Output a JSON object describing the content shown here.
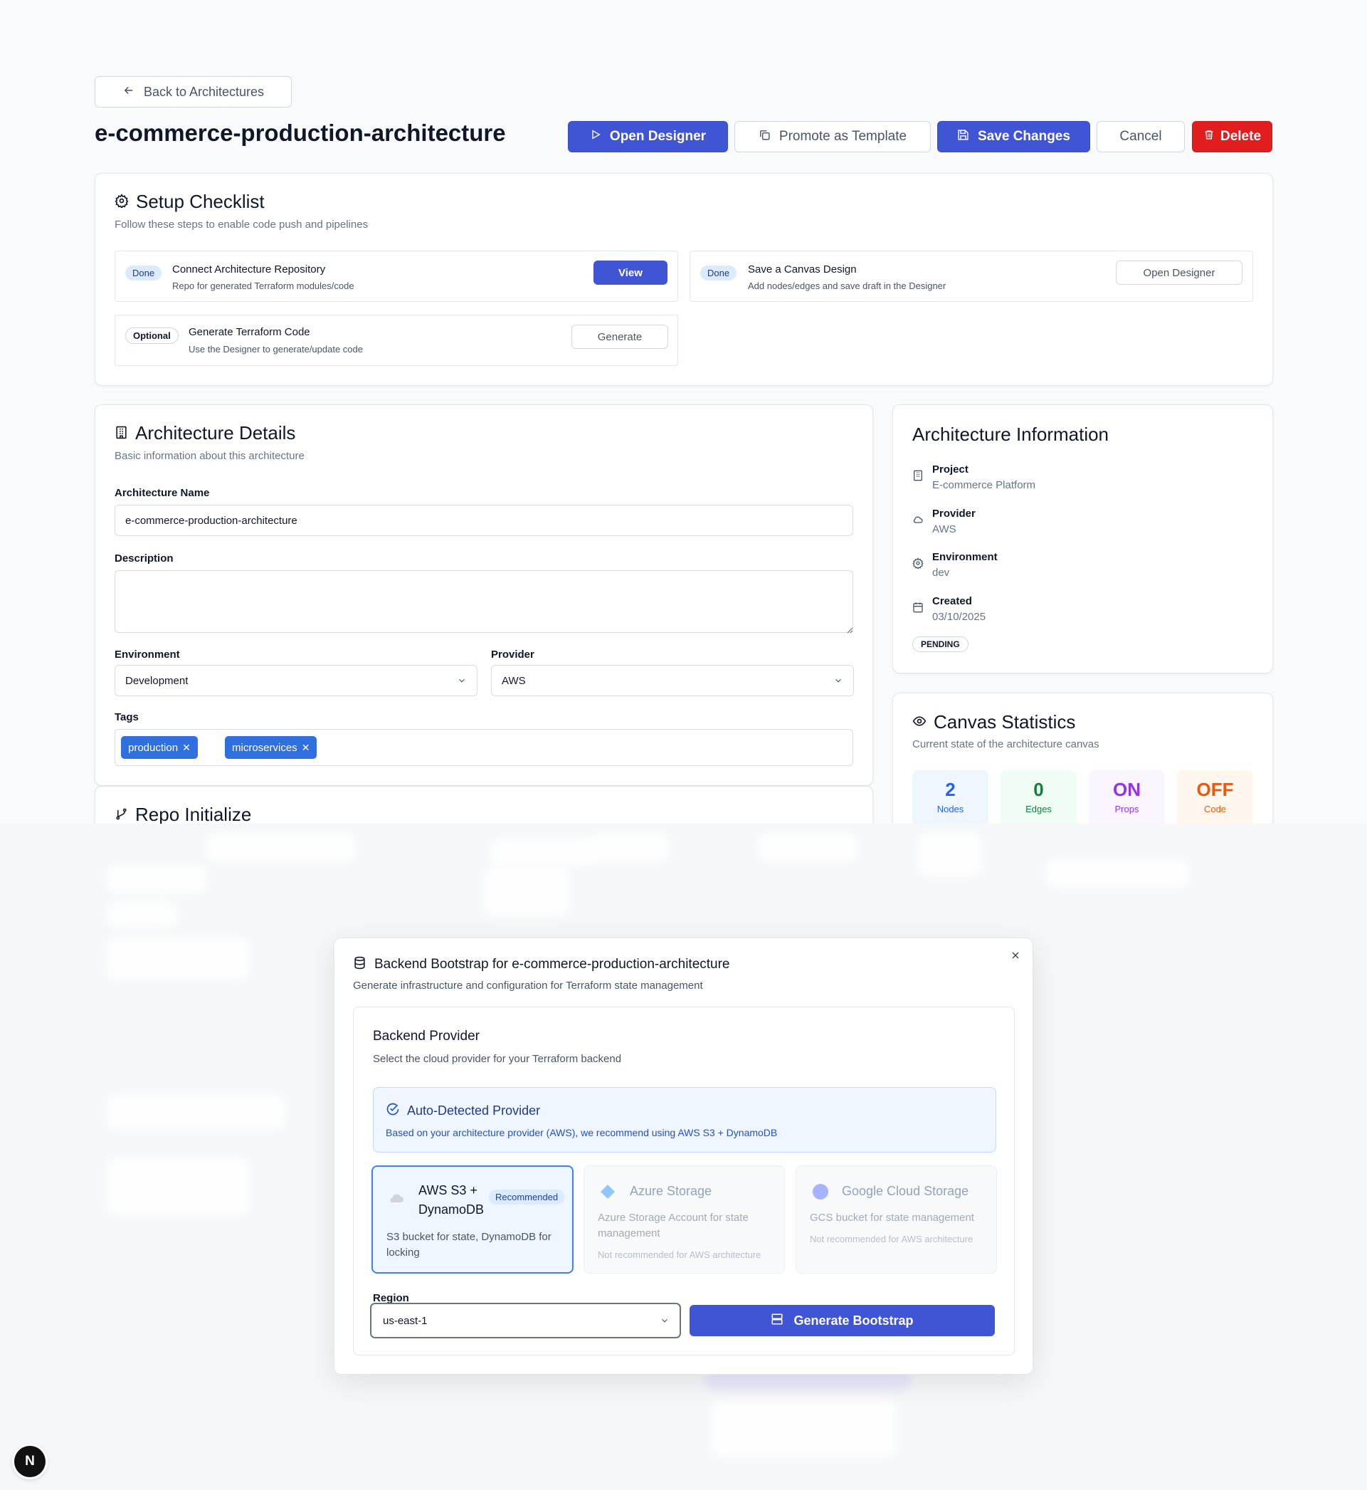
{
  "header": {
    "back_label": "Back to Architectures",
    "page_title": "e-commerce-production-architecture",
    "actions": {
      "open_designer": "Open Designer",
      "promote": "Promote as Template",
      "save": "Save Changes",
      "cancel": "Cancel",
      "delete": "Delete"
    }
  },
  "checklist": {
    "title": "Setup Checklist",
    "subtitle": "Follow these steps to enable code push and pipelines",
    "items": [
      {
        "badge": "Done",
        "title": "Connect Architecture Repository",
        "sub": "Repo for generated Terraform modules/code",
        "button": "View"
      },
      {
        "badge": "Done",
        "title": "Save a Canvas Design",
        "sub": "Add nodes/edges and save draft in the Designer",
        "button": "Open Designer"
      },
      {
        "badge": "Optional",
        "title": "Generate Terraform Code",
        "sub": "Use the Designer to generate/update code",
        "button": "Generate"
      }
    ]
  },
  "details": {
    "title": "Architecture Details",
    "subtitle": "Basic information about this architecture",
    "name_label": "Architecture Name",
    "name_value": "e-commerce-production-architecture",
    "description_label": "Description",
    "description_value": "",
    "environment_label": "Environment",
    "environment_value": "Development",
    "provider_label": "Provider",
    "provider_value": "AWS",
    "tags_label": "Tags",
    "tags": [
      "production",
      "microservices"
    ]
  },
  "repo_init": {
    "title": "Repo Initialize"
  },
  "info": {
    "title": "Architecture Information",
    "rows": [
      {
        "label": "Project",
        "value": "E-commerce Platform",
        "icon": "building-icon"
      },
      {
        "label": "Provider",
        "value": "AWS",
        "icon": "cloud-icon"
      },
      {
        "label": "Environment",
        "value": "dev",
        "icon": "gear-icon"
      },
      {
        "label": "Created",
        "value": "03/10/2025",
        "icon": "calendar-icon"
      }
    ],
    "status": "PENDING"
  },
  "stats": {
    "title": "Canvas Statistics",
    "subtitle": "Current state of the architecture canvas",
    "items": [
      {
        "value": "2",
        "label": "Nodes",
        "color": "#2563eb",
        "bg": "#eff6ff"
      },
      {
        "value": "0",
        "label": "Edges",
        "color": "#15803d",
        "bg": "#f0fdf4"
      },
      {
        "value": "ON",
        "label": "Props",
        "color": "#9333ea",
        "bg": "#faf5ff"
      },
      {
        "value": "OFF",
        "label": "Code",
        "color": "#ea580c",
        "bg": "#fff7ed"
      }
    ]
  },
  "modal": {
    "title": "Backend Bootstrap for e-commerce-production-architecture",
    "subtitle": "Generate infrastructure and configuration for Terraform state management",
    "provider_title": "Backend Provider",
    "provider_sub": "Select the cloud provider for your Terraform backend",
    "auto_title": "Auto-Detected Provider",
    "auto_text": "Based on your architecture provider (AWS), we recommend using AWS S3 + DynamoDB",
    "options": [
      {
        "name_line1": "AWS S3 +",
        "name_line2": "DynamoDB",
        "badge": "Recommended",
        "desc": "S3 bucket for state, DynamoDB for locking"
      },
      {
        "name": "Azure Storage",
        "desc": "Azure Storage Account for state management",
        "note": "Not recommended for AWS architecture"
      },
      {
        "name": "Google Cloud Storage",
        "desc": "GCS bucket for state management",
        "note": "Not recommended for AWS architecture"
      }
    ],
    "region_label": "Region",
    "region_value": "us-east-1",
    "generate_label": "Generate Bootstrap"
  },
  "dev_badge": "N"
}
